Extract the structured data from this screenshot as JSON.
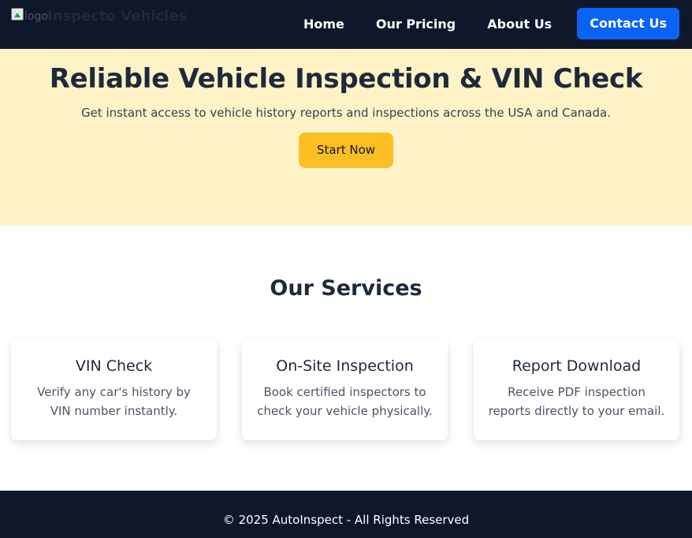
{
  "nav": {
    "logo_alt": "logo",
    "brand": "Inspecto Vehicles",
    "links": [
      "Home",
      "Our Pricing",
      "About Us"
    ],
    "cta": "Contact Us"
  },
  "hero": {
    "title": "Reliable Vehicle Inspection & VIN Check",
    "subtitle": "Get instant access to vehicle history reports and inspections across the USA and Canada.",
    "button": "Start Now"
  },
  "services": {
    "title": "Our Services",
    "items": [
      {
        "title": "VIN Check",
        "description": "Verify any car's history by VIN number instantly."
      },
      {
        "title": "On-Site Inspection",
        "description": "Book certified inspectors to check your vehicle physically."
      },
      {
        "title": "Report Download",
        "description": "Receive PDF inspection reports directly to your email."
      }
    ]
  },
  "footer": {
    "text": "© 2025 AutoInspect - All Rights Reserved"
  },
  "colors": {
    "navbar": "#0f172a",
    "hero_bg": "#fef3c7",
    "primary": "#0b63f6",
    "accent": "#fbbf24"
  }
}
